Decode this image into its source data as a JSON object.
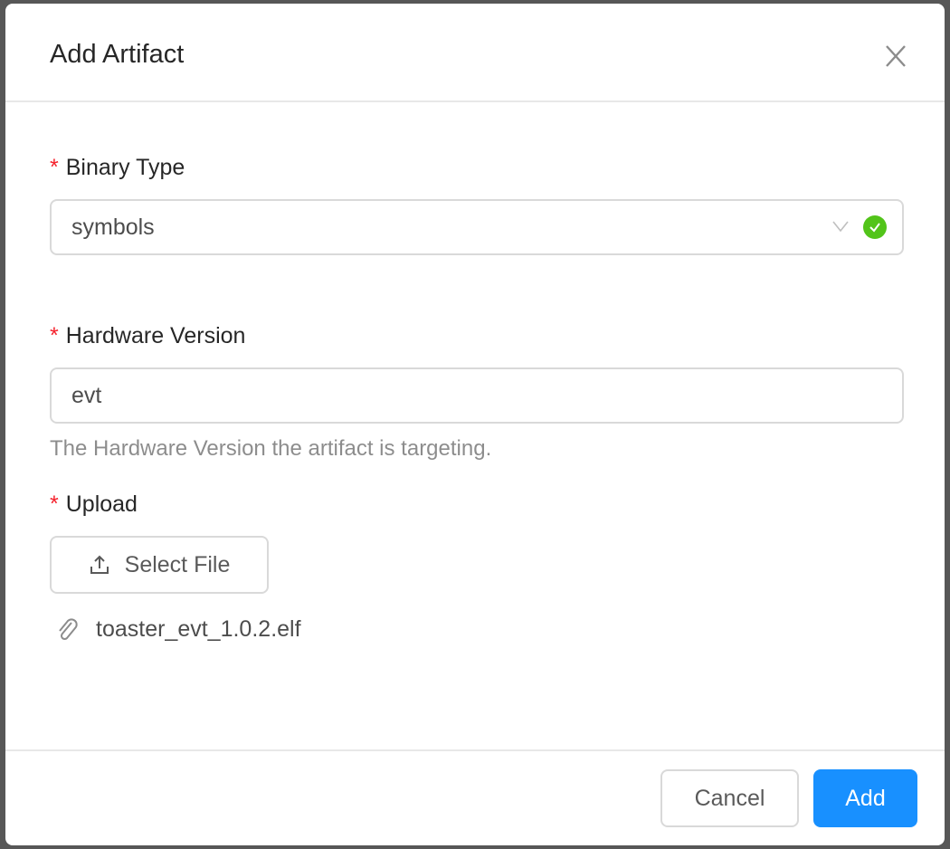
{
  "dialog": {
    "title": "Add Artifact",
    "fields": {
      "binary_type": {
        "label": "Binary Type",
        "required_mark": "*",
        "value": "symbols"
      },
      "hardware_version": {
        "label": "Hardware Version",
        "required_mark": "*",
        "value": "evt",
        "help": "The Hardware Version the artifact is targeting."
      },
      "upload": {
        "label": "Upload",
        "required_mark": "*",
        "button_label": "Select File",
        "file_name": "toaster_evt_1.0.2.elf"
      }
    },
    "footer": {
      "cancel_label": "Cancel",
      "add_label": "Add"
    }
  },
  "colors": {
    "primary": "#1890ff",
    "success": "#52c41a",
    "required": "#f5222d"
  }
}
